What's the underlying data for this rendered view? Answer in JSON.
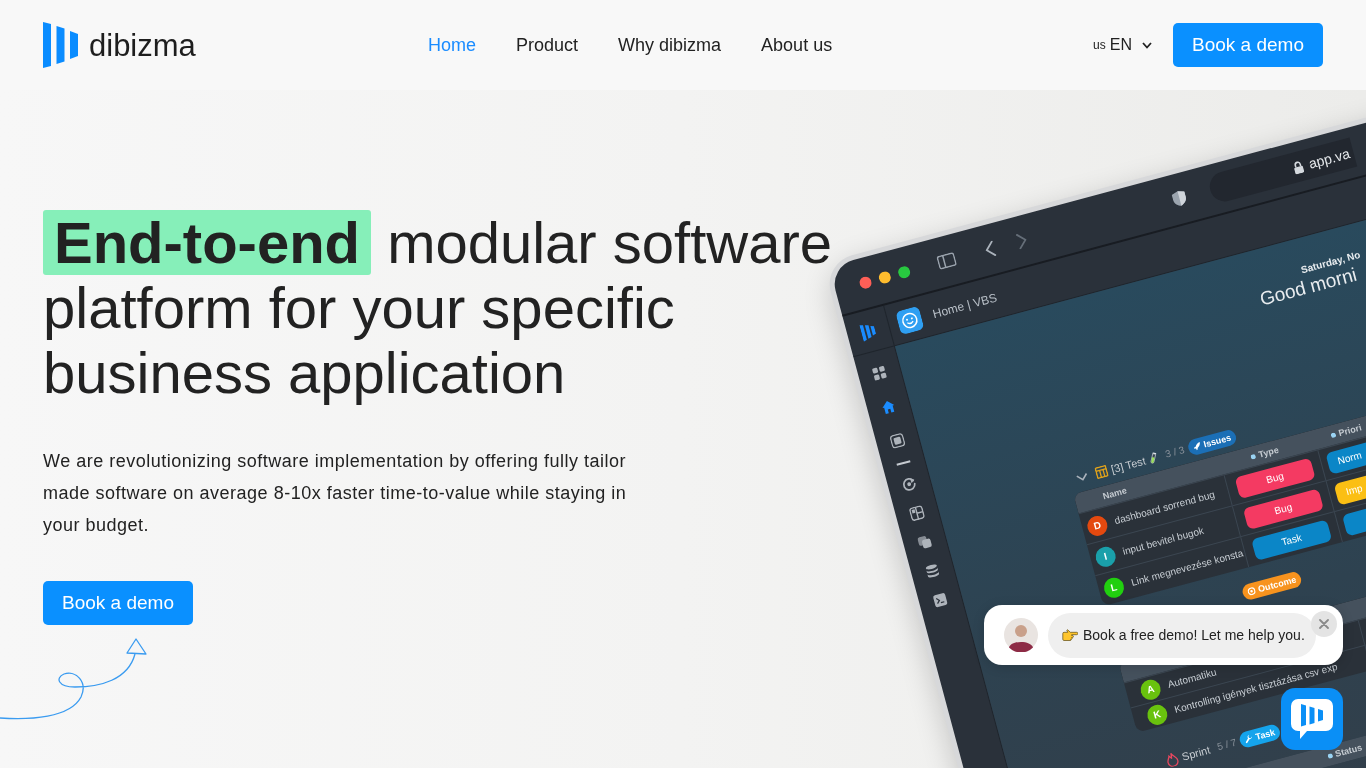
{
  "header": {
    "logo": "dibizma",
    "nav": [
      {
        "label": "Home",
        "selected": true
      },
      {
        "label": "Product",
        "selected": false
      },
      {
        "label": "Why dibizma",
        "selected": false
      },
      {
        "label": "About us",
        "selected": false
      }
    ],
    "language": {
      "flag": "us",
      "code": "EN"
    },
    "cta": "Book a demo"
  },
  "hero": {
    "heading": "**End-to-end** modular software platform for your specific business application",
    "description": "We are revolutionizing software implementation by offering fully tailor made software on average 8-10x faster time-to-value while staying in your budget.",
    "cta": "Book a demo"
  },
  "app_preview": {
    "address": "app.va",
    "breadcrumb": "Home | VBS",
    "sidebar": {
      "sections": [
        [
          {
            "selected": false
          },
          {
            "selected": true
          },
          {
            "selected": false
          }
        ],
        [
          {
            "selected": false
          },
          {
            "selected": false
          },
          {
            "selected": false
          },
          {
            "selected": false
          },
          {
            "selected": false
          }
        ]
      ]
    },
    "date": "Saturday, No",
    "greeting": "Good morni",
    "groups": [
      {
        "kind": "table",
        "expanded": true,
        "title": "[3] Test",
        "count": "3 / 3",
        "tag": {
          "label": "Issues",
          "color": "#1b6fb6",
          "kind": "rocket"
        },
        "columns": [
          {
            "label": "Name",
            "kind": "first"
          },
          {
            "label": "Type",
            "kind": "second"
          },
          {
            "label": "Priori",
            "kind": "third"
          }
        ],
        "rows": [
          {
            "initial": "D",
            "color": "#e4490f",
            "name": "dashboard sorrend bug",
            "type": {
              "label": "Bug",
              "color": "#f43a62"
            },
            "priority": {
              "label": "Norm",
              "color": "#0b86c7"
            }
          },
          {
            "initial": "I",
            "color": "#1aa0aa",
            "name": "input bevitel bugok",
            "type": {
              "label": "Bug",
              "color": "#f43a62"
            },
            "priority": {
              "label": "Imp",
              "color": "#fbbf14"
            }
          },
          {
            "initial": "L",
            "color": "#21cf0f",
            "name": "Link megnevezése konsta",
            "type": {
              "label": "Task",
              "color": "#0b86c7"
            },
            "priority": {
              "color": "#0b86c7"
            }
          }
        ]
      },
      {
        "kind": "partial",
        "tag": {
          "label": "Outcome",
          "color": "#f7931e",
          "kind": "target"
        },
        "rows": [
          {
            "initial": "A",
            "color": "#69c20e",
            "name": "Automatiku"
          },
          {
            "initial": "K",
            "color": "#69c20e",
            "name": "Kontrolling igények tisztázása csv exp"
          }
        ]
      },
      {
        "kind": "sprint",
        "title": "Sprint",
        "count": "5 / 7",
        "tag": {
          "label": "Task",
          "color": "#15a4ec",
          "kind": "tools"
        },
        "columns": [
          {
            "label": "Status",
            "kind": "second"
          }
        ]
      }
    ]
  },
  "chat_prompt": {
    "message": "Book a free demo! Let me help you."
  }
}
